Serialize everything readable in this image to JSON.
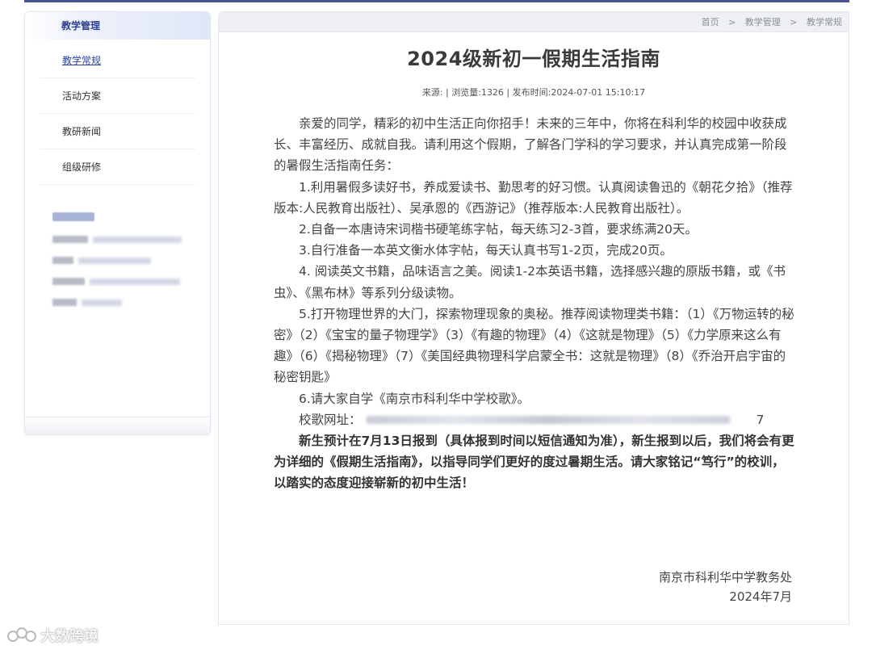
{
  "sidebar": {
    "header": "教学管理",
    "items": [
      {
        "label": "教学常规",
        "active": true
      },
      {
        "label": "活动方案",
        "active": false
      },
      {
        "label": "教研新闻",
        "active": false
      },
      {
        "label": "组级研修",
        "active": false
      }
    ]
  },
  "breadcrumb": {
    "items": [
      "首页",
      "教学管理",
      "教学常规"
    ],
    "separator": ">"
  },
  "article": {
    "title": "2024级新初一假期生活指南",
    "meta": "来源: | 浏览量:1326 | 发布时间:2024-07-01 15:10:17",
    "intro": "亲爱的同学，精彩的初中生活正向你招手！未来的三年中，你将在科利华的校园中收获成长、丰富经历、成就自我。请利用这个假期，了解各门学科的学习要求，并认真完成第一阶段的暑假生活指南任务：",
    "tasks": [
      "1.利用暑假多读好书，养成爱读书、勤思考的好习惯。认真阅读鲁迅的《朝花夕拾》（推荐版本:人民教育出版社）、吴承恩的《西游记》（推荐版本:人民教育出版社）。",
      "2.自备一本唐诗宋词楷书硬笔练字帖，每天练习2-3首，要求练满20天。",
      "3.自行准备一本英文衡水体字帖，每天认真书写1-2页，完成20页。",
      "4. 阅读英文书籍，品味语言之美。阅读1-2本英语书籍，选择感兴趣的原版书籍，或《书虫》、《黑布林》等系列分级读物。",
      "5.打开物理世界的大门，探索物理现象的奥秘。推荐阅读物理类书籍：（1）《万物运转的秘密》（2）《宝宝的量子物理学》（3）《有趣的物理》（4）《这就是物理》（5）《力学原来这么有趣》（6）《揭秘物理》（7）《美国经典物理科学启蒙全书：这就是物理》（8）《乔治开启宇宙的秘密钥匙》",
      "6.请大家自学《南京市科利华中学校歌》。"
    ],
    "url_label": "校歌网址：",
    "url_tail": "7",
    "notice": "新生预计在7月13日报到（具体报到时间以短信通知为准），新生报到以后，我们将会有更为详细的《假期生活指南》，以指导同学们更好的度过暑期生活。请大家铭记“笃行”的校训，以踏实的态度迎接崭新的初中生活！",
    "signature": "南京市科利华中学教务处",
    "date": "2024年7月"
  },
  "watermark": {
    "text": "大数跨境"
  },
  "colors": {
    "accent": "#2b45a6",
    "top_rule": "#4a5694",
    "breadcrumb_bg": "#eef0f4"
  }
}
